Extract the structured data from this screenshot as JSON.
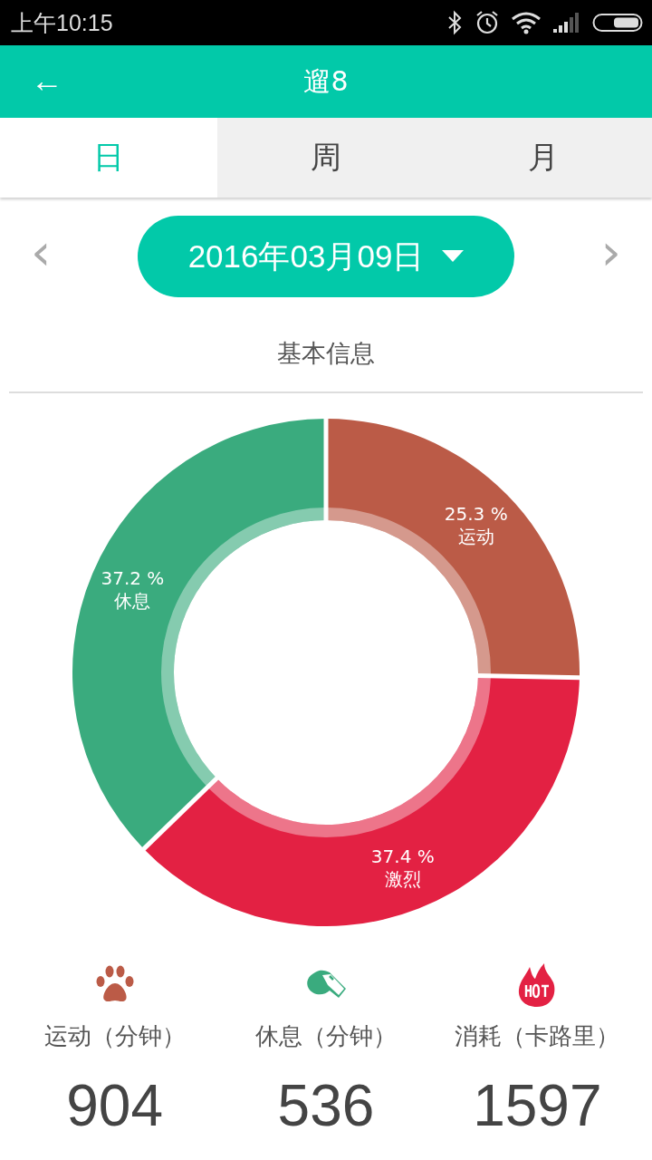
{
  "status_bar": {
    "time": "上午10:15"
  },
  "header": {
    "back_icon": "←",
    "title": "遛8"
  },
  "tabs": [
    {
      "label": "日",
      "selected": true
    },
    {
      "label": "周",
      "selected": false
    },
    {
      "label": "月",
      "selected": false
    }
  ],
  "date_picker": {
    "prev": "‹",
    "value": "2016年03月09日",
    "next": "›"
  },
  "section_title": "基本信息",
  "chart_data": {
    "type": "donut",
    "categories": [
      "运动",
      "激烈",
      "休息"
    ],
    "values": [
      25.3,
      37.4,
      37.2
    ],
    "colors": [
      "#bb5b47",
      "#e32143",
      "#3aab7e"
    ],
    "data_labels": true,
    "value_labels": [
      "25.3 %",
      "37.4 %",
      "37.2 %"
    ]
  },
  "stats": [
    {
      "kind": "paw",
      "color": "#bb5b47",
      "label": "运动（分钟）",
      "value": "904"
    },
    {
      "kind": "whistle",
      "color": "#3aab7e",
      "label": "休息（分钟）",
      "value": "536"
    },
    {
      "kind": "hot",
      "color": "#e32143",
      "label": "消耗（卡路里）",
      "value": "1597"
    }
  ]
}
